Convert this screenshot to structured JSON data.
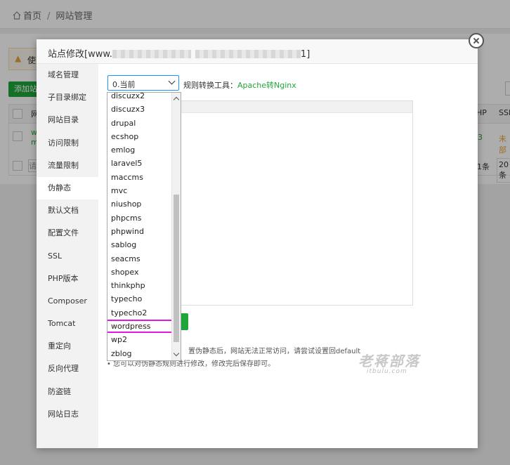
{
  "breadcrumb": {
    "home": "首页",
    "separator": "/",
    "current": "网站管理"
  },
  "background": {
    "warning_text": "使",
    "add_button": "添加站",
    "table_header_php": "HP",
    "table_header_ssl": "SSL",
    "php_value": "3",
    "ssl_value": "未部",
    "row_prefix": "w",
    "row_prefix2": "m",
    "pager_count": "1条",
    "pager_per": "20条",
    "pager_input": "请"
  },
  "modal": {
    "title_prefix": "站点修改[www.",
    "title_suffix": "1]",
    "sidebar": [
      "域名管理",
      "子目录绑定",
      "网站目录",
      "访问限制",
      "流量限制",
      "伪静态",
      "默认文档",
      "配置文件",
      "SSL",
      "PHP版本",
      "Composer",
      "Tomcat",
      "重定向",
      "反向代理",
      "防盗链",
      "网站日志"
    ],
    "active_index": 5,
    "select_value": "0.当前",
    "rule_label": "规则转换工具：",
    "rule_link": "Apache转Nginx",
    "tip1": "置伪静态后，网站无法正常访问，请尝试设置回default",
    "tip2": "• 您可以对伪静态规则进行修改，修改完后保存即可。",
    "watermark": "老蒋部落",
    "watermark_sub": "itbulu.com"
  },
  "dropdown": {
    "options": [
      "discuzx2",
      "discuzx3",
      "drupal",
      "ecshop",
      "emlog",
      "laravel5",
      "maccms",
      "mvc",
      "niushop",
      "phpcms",
      "phpwind",
      "sablog",
      "seacms",
      "shopex",
      "thinkphp",
      "typecho",
      "typecho2",
      "wordpress",
      "wp2",
      "zblog"
    ],
    "highlighted": "wordpress"
  },
  "colors": {
    "accent": "#20a53a",
    "focus": "#1e90ff",
    "highlight": "#e019e0"
  }
}
